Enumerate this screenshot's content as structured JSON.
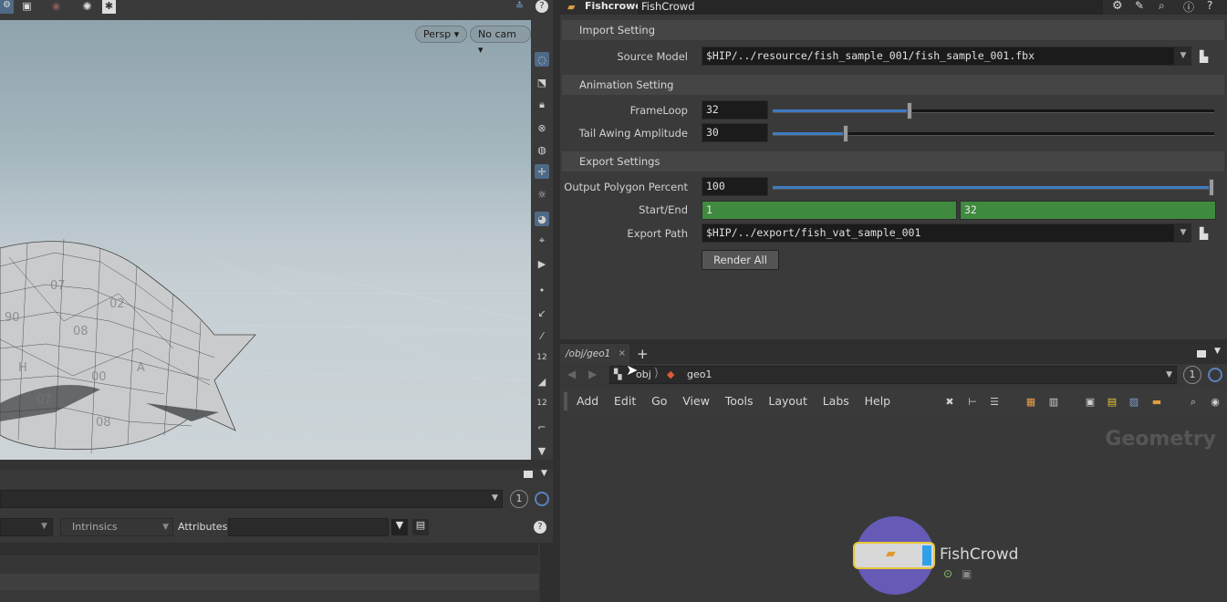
{
  "parameters": {
    "node_type": "Fishcrowd",
    "node_name": "FishCrowd",
    "sections": {
      "import": "Import Setting",
      "animation": "Animation Setting",
      "export": "Export Settings"
    },
    "source_model": {
      "label": "Source Model",
      "value": "$HIP/../resource/fish_sample_001/fish_sample_001.fbx"
    },
    "frame_loop": {
      "label": "FrameLoop",
      "value": "32",
      "fraction": 0.31
    },
    "tail_amp": {
      "label": "Tail Awing Amplitude",
      "value": "30",
      "fraction": 0.165
    },
    "poly_percent": {
      "label": "Output Polygon Percent",
      "value": "100",
      "fraction": 1.0
    },
    "start_end": {
      "label": "Start/End",
      "start": "1",
      "end": "32"
    },
    "export_path": {
      "label": "Export Path",
      "value": "$HIP/../export/fish_vat_sample_001"
    },
    "render_all": "Render All"
  },
  "viewport": {
    "persp_label": "Persp ▾",
    "cam_label": "No cam ▾"
  },
  "left_bottom": {
    "intrinsics": "Intrinsics",
    "attributes_label": "Attributes:",
    "counter": "1"
  },
  "network": {
    "tab_label": "/obj/geo1",
    "add_tab": "+",
    "path_obj": "obj",
    "path_geo": "geo1",
    "counter": "1",
    "menu": [
      "Add",
      "Edit",
      "Go",
      "View",
      "Tools",
      "Layout",
      "Labs",
      "Help"
    ],
    "context_label": "Geometry",
    "node_name": "FishCrowd"
  },
  "colors": {
    "accent_blue": "#3f7bc1",
    "green_field": "#3f8a3f",
    "node_ring": "#6a5fc4",
    "node_outline": "#e6c637"
  }
}
